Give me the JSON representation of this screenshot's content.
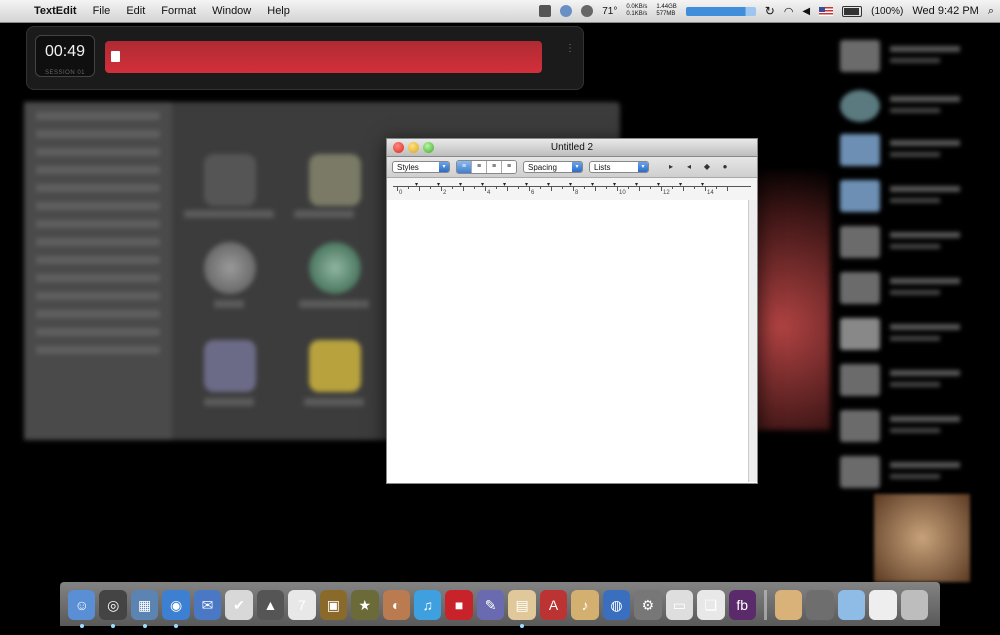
{
  "menubar": {
    "app_name": "TextEdit",
    "menus": [
      "File",
      "Edit",
      "Format",
      "Window",
      "Help"
    ],
    "status": {
      "temperature": "71°",
      "net_up": "0.0KB/s",
      "net_down": "0.1KB/s",
      "mem_free": "1.44GB",
      "mem_used": "577MB",
      "battery": "(100%)",
      "clock": "Wed 9:42 PM"
    }
  },
  "timer": {
    "time": "00:49",
    "session": "SESSION 01",
    "progress": 0.97,
    "accent": "#d32f3a"
  },
  "textedit": {
    "title": "Untitled 2",
    "styles_label": "Styles",
    "spacing_label": "Spacing",
    "lists_label": "Lists",
    "ruler_numbers": [
      "0",
      "2",
      "4",
      "6",
      "8",
      "10",
      "12",
      "14"
    ],
    "document_text": ""
  },
  "dock": {
    "icons": [
      "finder-icon",
      "dashboard-icon",
      "preview-icon",
      "safari-icon",
      "mail-icon",
      "calendar-notes-icon",
      "automator-icon",
      "ical-icon",
      "iphoto-icon",
      "star-icon",
      "photo-booth-icon",
      "itunes-icon",
      "photoshop-icon",
      "pen-icon",
      "textedit-icon",
      "dictionary-icon",
      "microphone-icon",
      "network-icon",
      "preferences-icon",
      "screen-icon",
      "app-icon",
      "flashbuilder-icon"
    ],
    "stack_icons": [
      "downloads-icon",
      "scanner-icon",
      "folder-icon",
      "document-icon",
      "trash-icon"
    ]
  }
}
